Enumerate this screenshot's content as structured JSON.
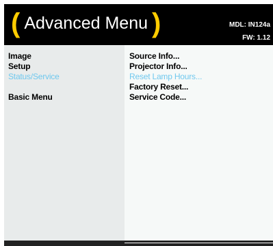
{
  "header": {
    "paren_open": "(",
    "title": "Advanced Menu",
    "paren_close": ")",
    "model": "MDL: IN124a",
    "firmware": "FW: 1.12"
  },
  "left_menu": {
    "items": [
      {
        "label": "Image",
        "selected": false
      },
      {
        "label": "Setup",
        "selected": false
      },
      {
        "label": "Status/Service",
        "selected": true
      },
      {
        "label": "Basic Menu",
        "selected": false
      }
    ]
  },
  "right_menu": {
    "items": [
      {
        "label": "Source Info...",
        "selected": false
      },
      {
        "label": "Projector Info...",
        "selected": false
      },
      {
        "label": "Reset Lamp Hours...",
        "selected": true
      },
      {
        "label": "Factory Reset...",
        "selected": false
      },
      {
        "label": "Service Code...",
        "selected": false
      }
    ]
  },
  "colors": {
    "header_bg": "#000000",
    "paren": "#ffcc00",
    "selected_text": "#6fc8ee",
    "left_panel_bg": "#e8ebeb",
    "right_panel_bg": "#f6f9f8"
  }
}
